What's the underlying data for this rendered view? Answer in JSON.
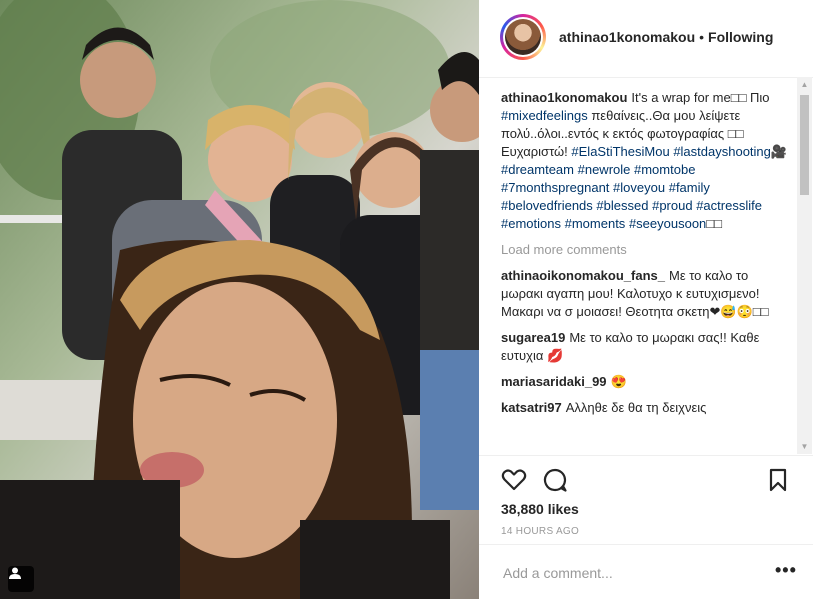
{
  "post": {
    "username": "athinao1konomakou",
    "separator": "•",
    "follow_status": "Following"
  },
  "caption": {
    "username": "athinao1konomakou",
    "segments": [
      {
        "type": "text",
        "value": "It's a wrap for me□□ Πιο "
      },
      {
        "type": "tag",
        "value": "#mixedfeelings"
      },
      {
        "type": "text",
        "value": " πεθαίνεις..Θα μου λείψετε πολύ..όλοι..εντός κ εκτός φωτογραφίας □□ Ευχαριστώ! "
      },
      {
        "type": "tag",
        "value": "#ElaStiThesiMou"
      },
      {
        "type": "text",
        "value": " "
      },
      {
        "type": "tag",
        "value": "#lastdayshooting"
      },
      {
        "type": "text",
        "value": "🎥 "
      },
      {
        "type": "tag",
        "value": "#dreamteam"
      },
      {
        "type": "text",
        "value": " "
      },
      {
        "type": "tag",
        "value": "#newrole"
      },
      {
        "type": "text",
        "value": " "
      },
      {
        "type": "tag",
        "value": "#momtobe"
      },
      {
        "type": "text",
        "value": " "
      },
      {
        "type": "tag",
        "value": "#7monthspregnant"
      },
      {
        "type": "text",
        "value": " "
      },
      {
        "type": "tag",
        "value": "#loveyou"
      },
      {
        "type": "text",
        "value": " "
      },
      {
        "type": "tag",
        "value": "#family"
      },
      {
        "type": "text",
        "value": " "
      },
      {
        "type": "tag",
        "value": "#belovedfriends"
      },
      {
        "type": "text",
        "value": " "
      },
      {
        "type": "tag",
        "value": "#blessed"
      },
      {
        "type": "text",
        "value": " "
      },
      {
        "type": "tag",
        "value": "#proud"
      },
      {
        "type": "text",
        "value": " "
      },
      {
        "type": "tag",
        "value": "#actresslife"
      },
      {
        "type": "text",
        "value": " "
      },
      {
        "type": "tag",
        "value": "#emotions"
      },
      {
        "type": "text",
        "value": " "
      },
      {
        "type": "tag",
        "value": "#moments"
      },
      {
        "type": "text",
        "value": " "
      },
      {
        "type": "tag",
        "value": "#seeyousoon"
      },
      {
        "type": "text",
        "value": "□□"
      }
    ]
  },
  "load_more": "Load more comments",
  "comments": [
    {
      "username": "athinaoikonomakou_fans_",
      "text": "Με το καλο το μωρακι αγαπη μου! Καλοτυχο κ ευτυχισμενο! Μακαρι να σ μοιασει! Θεοτητα σκετη❤😅😳□□"
    },
    {
      "username": "sugarea19",
      "text": "Με το καλο το μωρακι σας!! Καθε ευτυχια 💋"
    },
    {
      "username": "mariasaridaki_99",
      "text": "😍"
    },
    {
      "username": "katsatri97",
      "text": "Αλληθε δε θα τη δειχνεις"
    }
  ],
  "likes": "38,880 likes",
  "timestamp": "14 HOURS AGO",
  "add_comment_placeholder": "Add a comment...",
  "more_options": "•••",
  "icons": {
    "like": "heart-icon",
    "comment": "comment-icon",
    "save": "bookmark-icon",
    "tag": "user-tag-icon"
  },
  "colors": {
    "hashtag": "#003569",
    "muted": "#999999",
    "text": "#262626"
  }
}
